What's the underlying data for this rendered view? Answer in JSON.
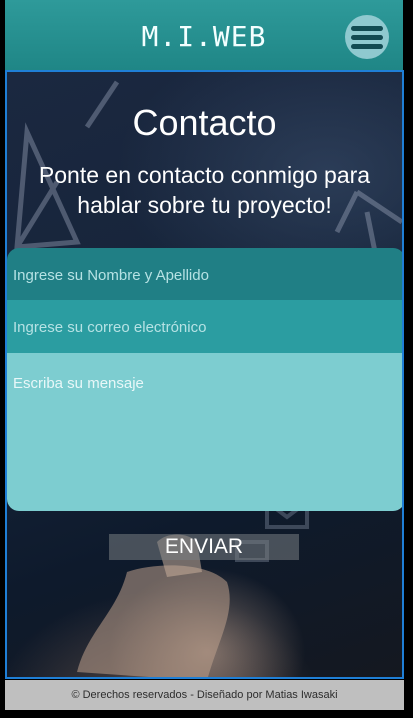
{
  "header": {
    "brand": "M.I.WEB",
    "menu_icon": "hamburger-menu-icon",
    "color": "#2e9a9a"
  },
  "contact": {
    "title": "Contacto",
    "subtitle": "Ponte en contacto conmigo para hablar sobre tu proyecto!"
  },
  "form": {
    "name_placeholder": "Ingrese su Nombre y Apellido",
    "email_placeholder": "Ingrese su correo electrónico",
    "message_placeholder": "Escriba su mensaje",
    "send_label": "ENVIAR"
  },
  "footer": {
    "text": "© Derechos reservados - Diseñado por Matias Iwasaki"
  }
}
